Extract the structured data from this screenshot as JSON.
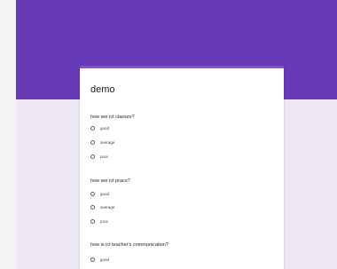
{
  "form": {
    "title": "demo",
    "questions": [
      {
        "text": "how are ict classes?",
        "options": [
          "good",
          "average",
          "poor"
        ]
      },
      {
        "text": "how are ict pracs?",
        "options": [
          "good",
          "average",
          "poor"
        ]
      },
      {
        "text": "how is ict teacher's communication?",
        "options": [
          "good"
        ]
      }
    ]
  },
  "colors": {
    "header": "#673ab7",
    "background": "#ede7f6",
    "card": "#ffffff"
  }
}
